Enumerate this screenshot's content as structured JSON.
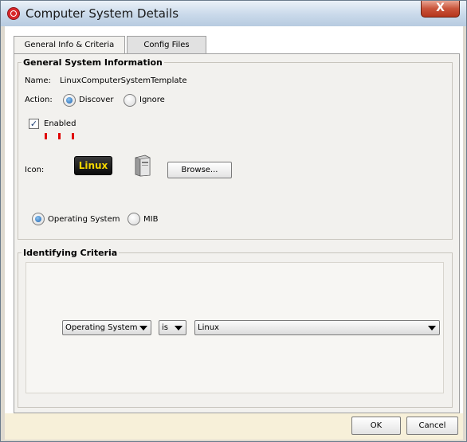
{
  "window": {
    "title": "Computer System Details",
    "close_label": "X"
  },
  "tabs": [
    {
      "label": "General Info & Criteria",
      "active": true
    },
    {
      "label": "Config Files",
      "active": false
    }
  ],
  "general_info": {
    "legend": "General System Information",
    "name_label": "Name:",
    "name_value": "LinuxComputerSystemTemplate",
    "action_label": "Action:",
    "action_options": [
      {
        "label": "Discover",
        "selected": true
      },
      {
        "label": "Ignore",
        "selected": false
      }
    ],
    "enabled_label": "Enabled",
    "enabled_checked": true,
    "icon_label": "Icon:",
    "icon_badge_text": "Linux",
    "browse_label": "Browse...",
    "source_options": [
      {
        "label": "Operating System",
        "selected": true
      },
      {
        "label": "MIB",
        "selected": false
      }
    ]
  },
  "criteria": {
    "legend": "Identifying Criteria",
    "field_select": "Operating System",
    "operator_select": "is",
    "value_select": "Linux"
  },
  "footer": {
    "ok_label": "OK",
    "cancel_label": "Cancel"
  },
  "colors": {
    "tick_marks": "#e00000",
    "linux_badge_text": "#f2d400",
    "radio_selected": "#1c63b0"
  }
}
